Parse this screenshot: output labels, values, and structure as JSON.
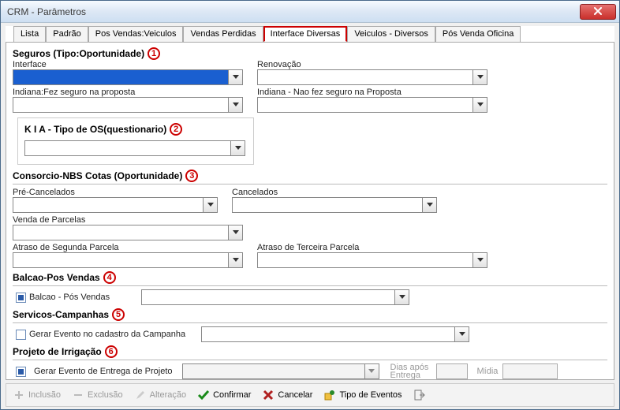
{
  "window": {
    "title": "CRM - Parâmetros"
  },
  "tabs": {
    "items": [
      {
        "label": "Lista"
      },
      {
        "label": "Padrão"
      },
      {
        "label": "Pos Vendas:Veiculos"
      },
      {
        "label": "Vendas Perdidas"
      },
      {
        "label": "Interface Diversas"
      },
      {
        "label": "Veiculos - Diversos"
      },
      {
        "label": "Pós Venda Oficina"
      }
    ],
    "active_index": 4
  },
  "groups": {
    "seguros": {
      "title": "Seguros (Tipo:Oportunidade)",
      "marker": "1",
      "fields": {
        "interface_label": "Interface",
        "renovacao_label": "Renovação",
        "indiana_sim_label": "Indiana:Fez seguro na proposta",
        "indiana_nao_label": "Indiana - Nao fez seguro na Proposta"
      }
    },
    "kia": {
      "title": "K I A - Tipo de OS(questionario)",
      "marker": "2"
    },
    "consorcio": {
      "title": "Consorcio-NBS Cotas (Oportunidade)",
      "marker": "3",
      "fields": {
        "pre_cancelados": "Pré-Cancelados",
        "cancelados": "Cancelados",
        "venda_parcelas": "Venda de Parcelas",
        "atraso2": "Atraso de Segunda Parcela",
        "atraso3": "Atraso de Terceira Parcela"
      }
    },
    "balcao": {
      "title": "Balcao-Pos Vendas",
      "marker": "4",
      "checkbox_label": "Balcao - Pós Vendas"
    },
    "servicos": {
      "title": "Servicos-Campanhas",
      "marker": "5",
      "checkbox_label": "Gerar Evento no cadastro da Campanha"
    },
    "irrigacao": {
      "title": "Projeto de Irrigação",
      "marker": "6",
      "checkbox_label": "Gerar Evento de Entrega de Projeto",
      "dias_label": "Dias após Entrega",
      "midia_label": "Mídia"
    }
  },
  "toolbar": {
    "inclusao": "Inclusão",
    "exclusao": "Exclusão",
    "alteracao": "Alteração",
    "confirmar": "Confirmar",
    "cancelar": "Cancelar",
    "tipo_eventos": "Tipo de Eventos"
  }
}
